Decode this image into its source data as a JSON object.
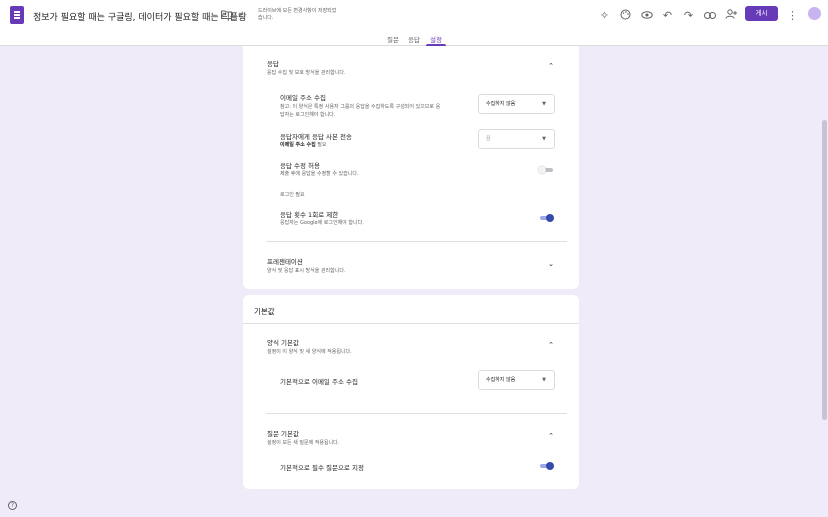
{
  "header": {
    "doc_title": "정보가 필요할 때는 구글링, 데이터가 필요할 때는 릭플링",
    "save_status": "드라이브에 모든 변경사항이 저장되었습니다.",
    "publish_label": "게시",
    "icons": [
      "folder-icon",
      "star-icon",
      "addon-icon",
      "palette-icon",
      "preview-icon",
      "undo-icon",
      "redo-icon",
      "link-icon",
      "add-collaborator-icon",
      "more-icon"
    ]
  },
  "tabs": [
    {
      "label": "질문",
      "active": false
    },
    {
      "label": "응답",
      "active": false
    },
    {
      "label": "설정",
      "active": true
    }
  ],
  "responses": {
    "title": "응답",
    "subtitle": "응답 수집 및 보호 방식을 관리합니다.",
    "email": {
      "title": "이메일 주소 수집",
      "desc_line1": "참고: 이 양식은 특정 사용자 그룹의 응답을 수집하도록 구성되어 있으므로 응",
      "desc_line2": "답자는 로그인해야 합니다.",
      "value": "수집하지 않음"
    },
    "copy": {
      "title": "응답자에게 응답 사본 전송",
      "desc_bold": "이메일 주소 수집",
      "desc_rest": " 필요",
      "value": "끔"
    },
    "edit": {
      "title": "응답 수정 허용",
      "desc": "제출 후에 응답을 수정할 수 있습니다.",
      "enabled": false
    },
    "login_required": "로그인 필요",
    "limit": {
      "title": "응답 횟수 1회로 제한",
      "desc": "응답자는 Google에 로그인해야 합니다.",
      "enabled": true
    }
  },
  "presentation": {
    "title": "프레젠테이션",
    "subtitle": "양식 및 응답 표시 방식을 관리합니다."
  },
  "defaults": {
    "title": "기본값",
    "form_defaults": {
      "title": "양식 기본값",
      "subtitle": "설정이 이 양식 및 새 양식에 적용됩니다.",
      "email_label": "기본적으로 이메일 주소 수집",
      "email_value": "수집하지 않음"
    },
    "question_defaults": {
      "title": "질문 기본값",
      "subtitle": "설정이 모든 새 질문에 적용됩니다.",
      "required_label": "기본적으로 필수 질문으로 지정",
      "required_enabled": true
    }
  },
  "help_icon": "?"
}
